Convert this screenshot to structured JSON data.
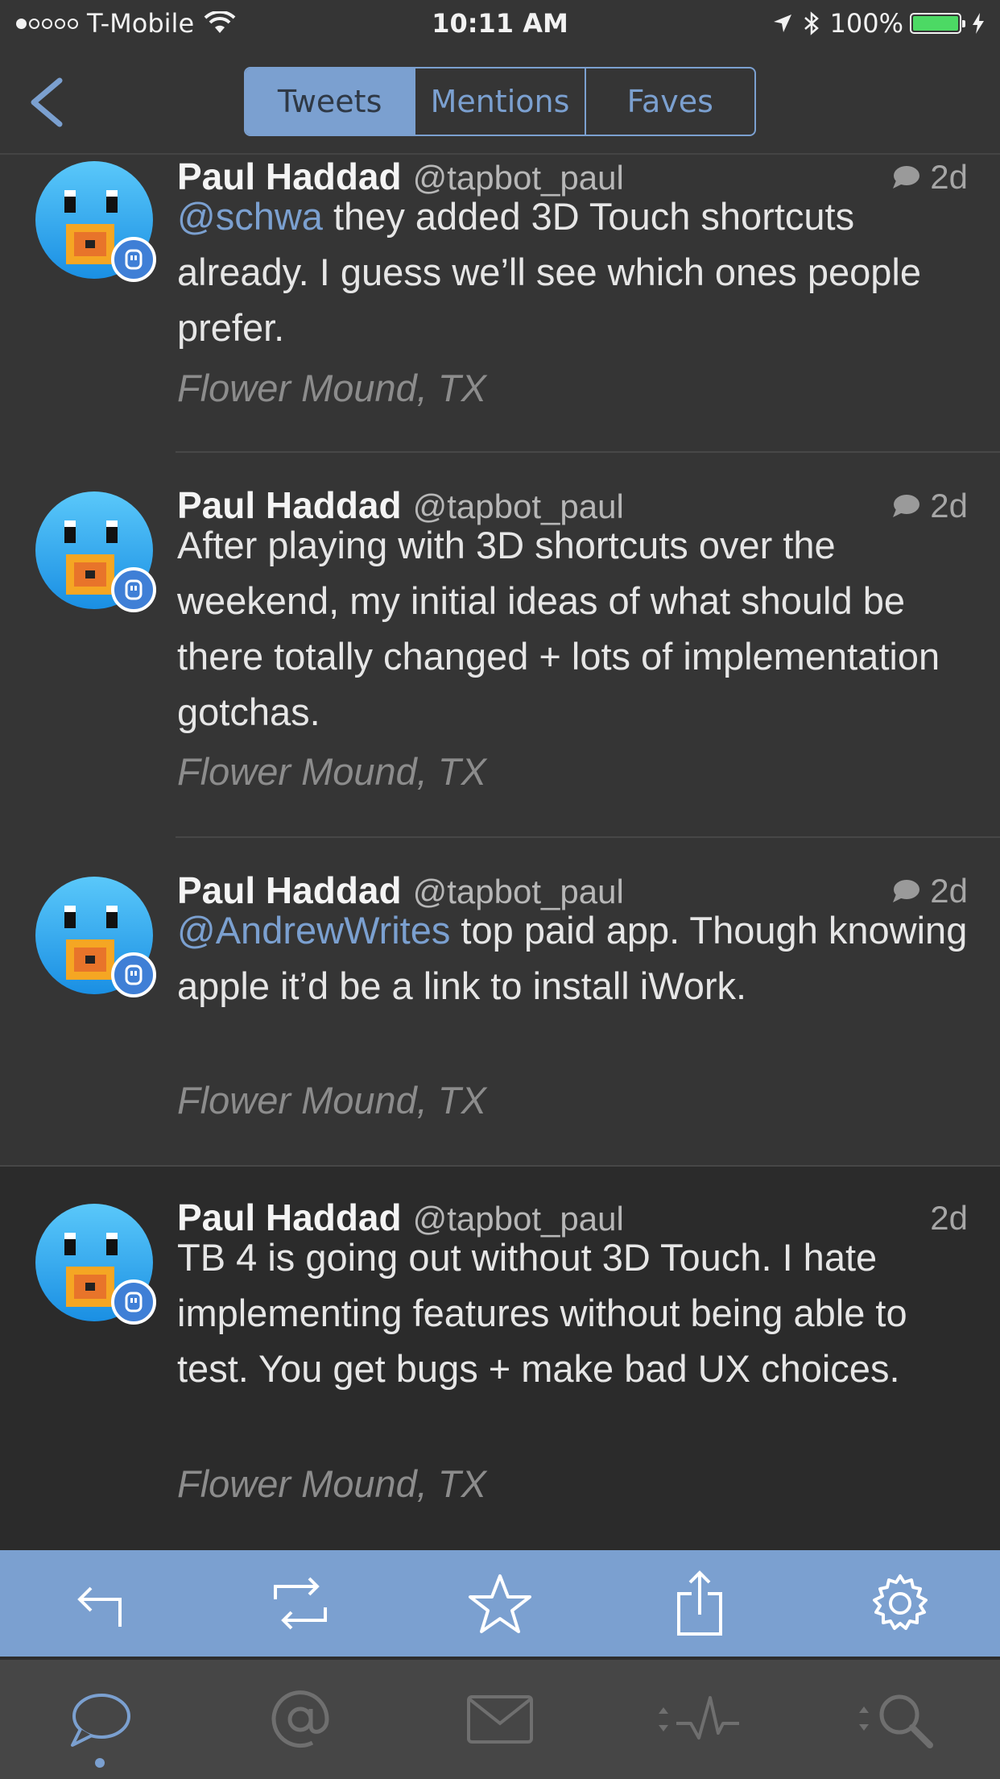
{
  "status_bar": {
    "carrier": "T-Mobile",
    "time": "10:11 AM",
    "battery": "100%",
    "signal_bars_filled": 1,
    "signal_bars_total": 5
  },
  "nav": {
    "segments": [
      "Tweets",
      "Mentions",
      "Faves"
    ],
    "active_segment": "Tweets"
  },
  "tweets": [
    {
      "name": "Paul Haddad",
      "handle": "@tapbot_paul",
      "time": "2d",
      "mention": "@schwa",
      "text": " they added 3D Touch shortcuts already. I guess we’ll see which ones people prefer.",
      "location": "Flower Mound, TX",
      "has_conversation_icon": true
    },
    {
      "name": "Paul Haddad",
      "handle": "@tapbot_paul",
      "time": "2d",
      "mention": "",
      "text": "After playing with 3D shortcuts over the weekend, my initial ideas of what should be there totally changed + lots of implementation gotchas.",
      "location": "Flower Mound, TX",
      "has_conversation_icon": true
    },
    {
      "name": "Paul Haddad",
      "handle": "@tapbot_paul",
      "time": "2d",
      "mention": "@AndrewWrites",
      "text": " top paid app. Though knowing apple it’d be a link to install iWork.",
      "location": "Flower Mound, TX",
      "has_conversation_icon": true
    },
    {
      "name": "Paul Haddad",
      "handle": "@tapbot_paul",
      "time": "2d",
      "mention": "",
      "text": "TB 4 is going out without 3D Touch. I hate implementing features without being able to test. You get bugs + make bad UX choices.",
      "location": "Flower Mound, TX",
      "has_conversation_icon": false
    }
  ],
  "action_bar": [
    "reply-icon",
    "retweet-icon",
    "star-icon",
    "share-icon",
    "gear-icon"
  ],
  "tab_bar": [
    "timeline-icon",
    "mentions-icon",
    "messages-icon",
    "activity-icon",
    "search-icon"
  ],
  "colors": {
    "accent": "#7ba0d0",
    "background": "#353535",
    "selected_row": "#2b2b2b"
  }
}
